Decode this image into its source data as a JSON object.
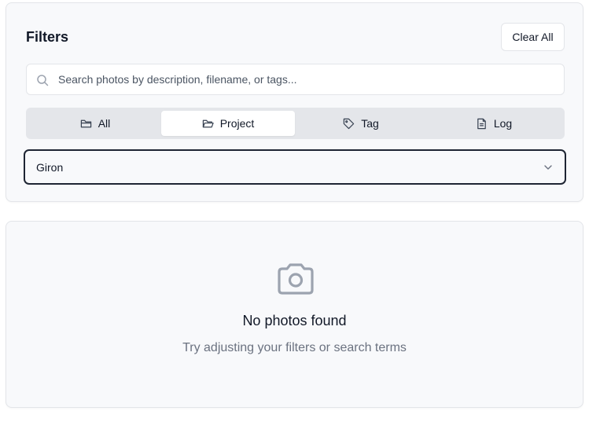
{
  "filters": {
    "title": "Filters",
    "clear_label": "Clear All",
    "search": {
      "placeholder": "Search photos by description, filename, or tags...",
      "value": ""
    },
    "tabs": [
      {
        "label": "All",
        "icon": "folder-icon",
        "active": false
      },
      {
        "label": "Project",
        "icon": "folder-open-icon",
        "active": true
      },
      {
        "label": "Tag",
        "icon": "tag-icon",
        "active": false
      },
      {
        "label": "Log",
        "icon": "document-icon",
        "active": false
      }
    ],
    "select": {
      "value": "Giron",
      "icon": "chevron-down-icon"
    }
  },
  "empty_state": {
    "icon": "camera-icon",
    "title": "No photos found",
    "subtitle": "Try adjusting your filters or search terms"
  },
  "colors": {
    "card_bg": "#f8f9fb",
    "border": "#e3e5e9",
    "tab_track": "#e4e6ea",
    "focus_ring": "#1e2533",
    "muted_text": "#6b7280",
    "icon_gray": "#9ca3af"
  }
}
